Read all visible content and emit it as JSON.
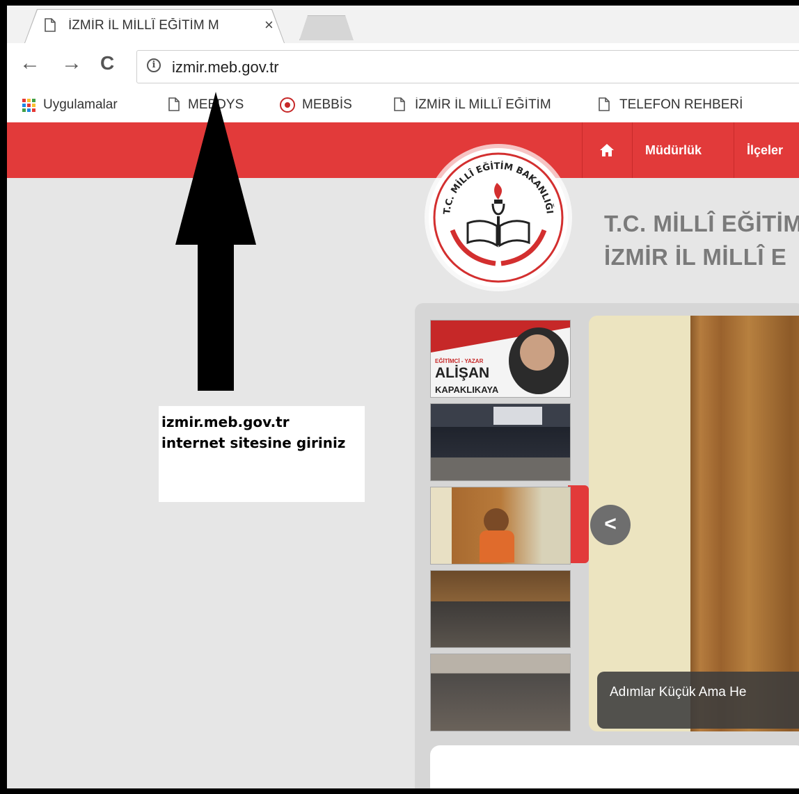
{
  "browser": {
    "tab_title": "İZMİR İL MİLLÎ EĞİTİM M",
    "close_glyph": "×",
    "back_glyph": "←",
    "forward_glyph": "→",
    "reload_glyph": "C",
    "url": "izmir.meb.gov.tr",
    "info_glyph": "i"
  },
  "bookmarks": [
    {
      "label": "Uygulamalar",
      "icon": "apps-grid-icon"
    },
    {
      "label": "MEBDYS",
      "icon": "page-icon"
    },
    {
      "label": "MEBBİS",
      "icon": "meb-logo-icon"
    },
    {
      "label": "İZMİR İL MİLLÎ EĞİTİM",
      "icon": "page-icon"
    },
    {
      "label": "TELEFON REHBERİ",
      "icon": "page-icon"
    }
  ],
  "site": {
    "nav": [
      {
        "label": "Müdürlük"
      },
      {
        "label": "İlçeler"
      }
    ],
    "home_icon": "home-icon",
    "logo_text": "T.C. MİLLÎ EĞİTİM BAKANLIĞI",
    "title_line1": "T.C. MİLLÎ EĞİTİM",
    "title_line2": "İZMİR İL MİLLÎ E",
    "slider": {
      "caption": "Adımlar Küçük Ama He",
      "prev_glyph": "<",
      "thumbs": [
        {
          "top_text": "EĞİTİMCİ - YAZAR",
          "name": "ALİŞAN",
          "surname": "KAPAKLIKAYA"
        },
        {
          "label": "group photo"
        },
        {
          "label": "speaker girl"
        },
        {
          "label": "auditorium"
        },
        {
          "label": "audience"
        }
      ]
    }
  },
  "annotation": {
    "line1": "izmir.meb.gov.tr",
    "line2": "internet sitesine giriniz"
  },
  "colors": {
    "brand_red": "#e23a3a"
  }
}
